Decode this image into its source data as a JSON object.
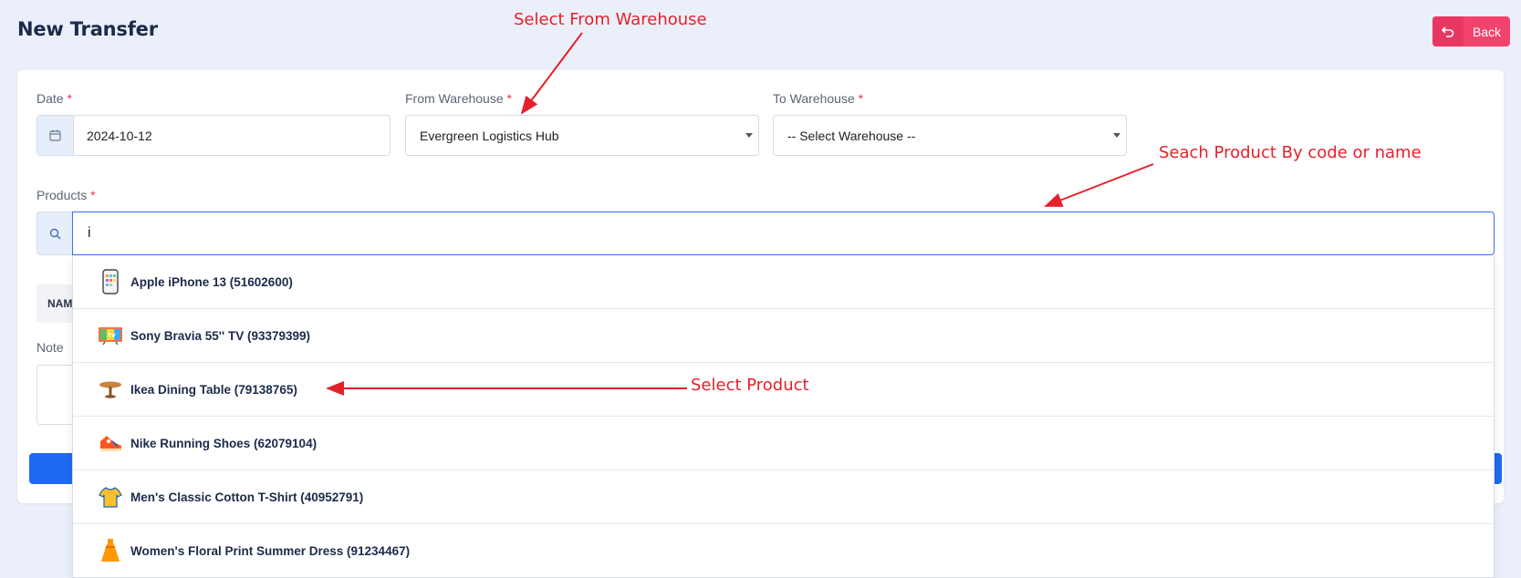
{
  "header": {
    "title": "New Transfer",
    "back_label": "Back"
  },
  "form": {
    "date": {
      "label": "Date",
      "required": "*",
      "value": "2024-10-12"
    },
    "from_warehouse": {
      "label": "From Warehouse",
      "required": "*",
      "value": "Evergreen Logistics Hub"
    },
    "to_warehouse": {
      "label": "To Warehouse",
      "required": "*",
      "value": "-- Select Warehouse --"
    },
    "products": {
      "label": "Products",
      "required": "*",
      "search_value": "i"
    },
    "table_head": "NAM",
    "note_label": "Note"
  },
  "dropdown": {
    "items": [
      {
        "label": "Apple iPhone 13 (51602600)",
        "icon": "phone-icon"
      },
      {
        "label": "Sony Bravia 55'' TV (93379399)",
        "icon": "tv-icon"
      },
      {
        "label": "Ikea Dining Table (79138765)",
        "icon": "table-icon"
      },
      {
        "label": "Nike Running Shoes (62079104)",
        "icon": "shoe-icon"
      },
      {
        "label": "Men's Classic Cotton T-Shirt (40952791)",
        "icon": "tshirt-icon"
      },
      {
        "label": "Women's Floral Print Summer Dress (91234467)",
        "icon": "dress-icon"
      }
    ]
  },
  "annotations": {
    "select_warehouse": "Select From Warehouse",
    "search_product": "Seach Product By code or name",
    "select_product": "Select Product"
  },
  "colors": {
    "accent": "#1e6af0",
    "back_button": "#f2436e",
    "annotation": "#e5202a",
    "background": "#ebeffa"
  }
}
